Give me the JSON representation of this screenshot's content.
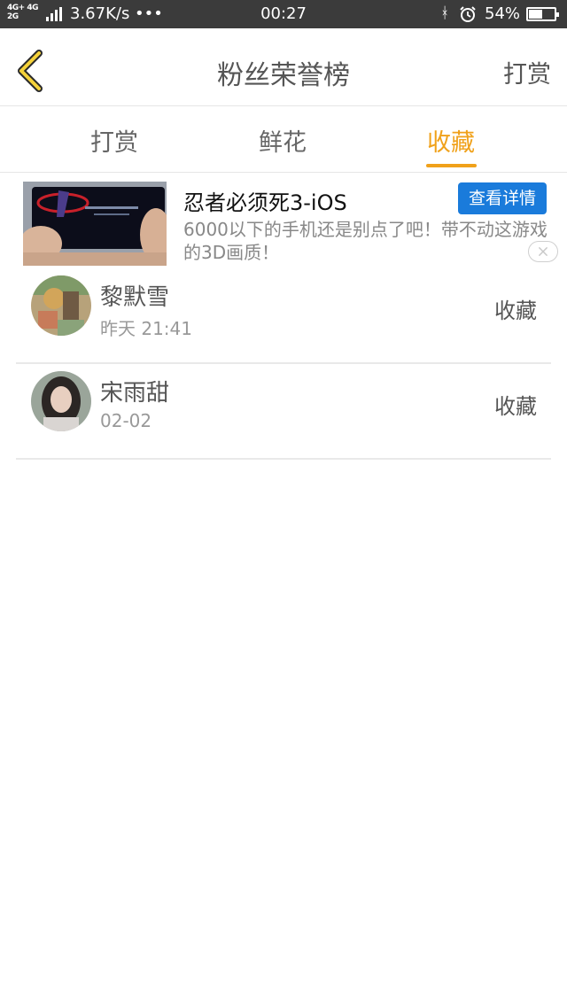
{
  "status_bar": {
    "net_top": "4G+ 4G",
    "net_bottom": "2G",
    "speed": "3.67K/s •••",
    "time": "00:27",
    "bluetooth_icon": "ᚼ",
    "battery_percent": "54%",
    "battery_level": 0.54
  },
  "header": {
    "title": "粉丝荣誉榜",
    "action": "打赏",
    "accent_color": "#f0a11a"
  },
  "tabs": [
    {
      "label": "打赏",
      "active": false
    },
    {
      "label": "鲜花",
      "active": false
    },
    {
      "label": "收藏",
      "active": true
    }
  ],
  "ad": {
    "title": "忍者必须死3-iOS",
    "button": "查看详情",
    "description": "6000以下的手机还是别点了吧！带不动这游戏的3D画质！",
    "button_color": "#1a7bdb"
  },
  "list": [
    {
      "name": "黎默雪",
      "time": "昨天 21:41",
      "action": "收藏"
    },
    {
      "name": "宋雨甜",
      "time": "02-02",
      "action": "收藏"
    }
  ]
}
